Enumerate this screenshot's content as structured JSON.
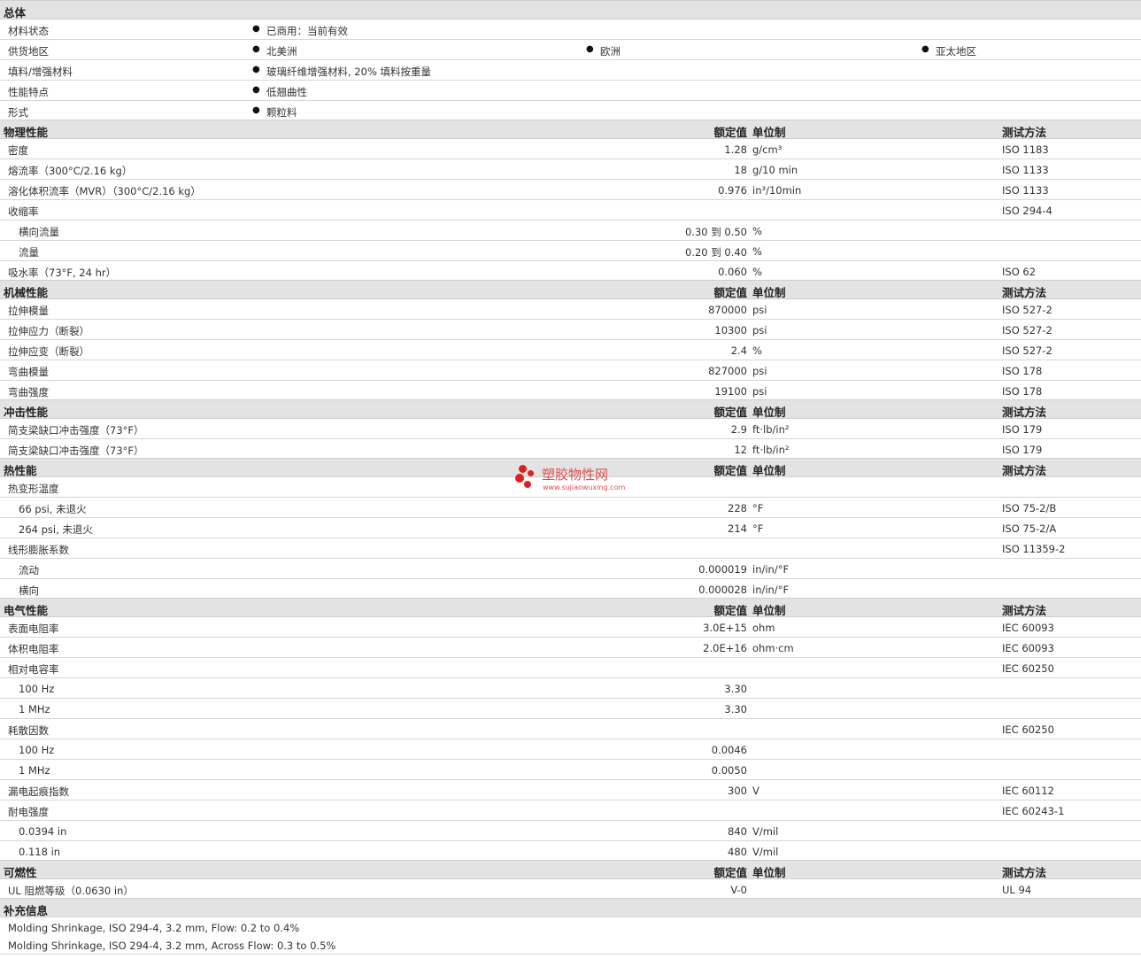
{
  "headers": {
    "nominal": "额定值",
    "unit": "单位制",
    "method": "测试方法"
  },
  "general": {
    "title": "总体",
    "rows": [
      {
        "label": "材料状态",
        "items": [
          "已商用：当前有效"
        ]
      },
      {
        "label": "供货地区",
        "items": [
          "北美洲",
          "欧洲",
          "亚太地区"
        ]
      },
      {
        "label": "填料/增强材料",
        "items": [
          "玻璃纤维增强材料, 20% 填料按重量"
        ]
      },
      {
        "label": "性能特点",
        "items": [
          "低翘曲性"
        ]
      },
      {
        "label": "形式",
        "items": [
          "颗粒料"
        ]
      }
    ]
  },
  "physical": {
    "title": "物理性能",
    "rows": [
      {
        "label": "密度",
        "value": "1.28",
        "unit": "g/cm³",
        "method": "ISO 1183"
      },
      {
        "label": "熔流率（300°C/2.16 kg）",
        "value": "18",
        "unit": "g/10 min",
        "method": "ISO 1133"
      },
      {
        "label": "溶化体积流率（MVR）（300°C/2.16 kg）",
        "value": "0.976",
        "unit": "in³/10min",
        "method": "ISO 1133"
      },
      {
        "label": "收缩率",
        "value": "",
        "unit": "",
        "method": "ISO 294-4"
      },
      {
        "label": "横向流量",
        "value": "0.30 到 0.50",
        "unit": "%",
        "method": "",
        "sub": true
      },
      {
        "label": "流量",
        "value": "0.20 到 0.40",
        "unit": "%",
        "method": "",
        "sub": true
      },
      {
        "label": "吸水率（73°F, 24 hr）",
        "value": "0.060",
        "unit": "%",
        "method": "ISO 62"
      }
    ]
  },
  "mechanical": {
    "title": "机械性能",
    "rows": [
      {
        "label": "拉伸模量",
        "value": "870000",
        "unit": "psi",
        "method": "ISO 527-2"
      },
      {
        "label": "拉伸应力（断裂）",
        "value": "10300",
        "unit": "psi",
        "method": "ISO 527-2"
      },
      {
        "label": "拉伸应变（断裂）",
        "value": "2.4",
        "unit": "%",
        "method": "ISO 527-2"
      },
      {
        "label": "弯曲模量",
        "value": "827000",
        "unit": "psi",
        "method": "ISO 178"
      },
      {
        "label": "弯曲强度",
        "value": "19100",
        "unit": "psi",
        "method": "ISO 178"
      }
    ]
  },
  "impact": {
    "title": "冲击性能",
    "rows": [
      {
        "label": "简支梁缺口冲击强度（73°F）",
        "value": "2.9",
        "unit": "ft·lb/in²",
        "method": "ISO 179"
      },
      {
        "label": "简支梁缺口冲击强度（73°F）",
        "value": "12",
        "unit": "ft·lb/in²",
        "method": "ISO 179"
      }
    ]
  },
  "thermal": {
    "title": "热性能",
    "rows": [
      {
        "label": "热变形温度",
        "value": "",
        "unit": "",
        "method": ""
      },
      {
        "label": "66 psi, 未退火",
        "value": "228",
        "unit": "°F",
        "method": "ISO 75-2/B",
        "sub": true
      },
      {
        "label": "264 psi, 未退火",
        "value": "214",
        "unit": "°F",
        "method": "ISO 75-2/A",
        "sub": true
      },
      {
        "label": "线形膨胀系数",
        "value": "",
        "unit": "",
        "method": "ISO 11359-2"
      },
      {
        "label": "流动",
        "value": "0.000019",
        "unit": "in/in/°F",
        "method": "",
        "sub": true
      },
      {
        "label": "横向",
        "value": "0.000028",
        "unit": "in/in/°F",
        "method": "",
        "sub": true
      }
    ]
  },
  "electrical": {
    "title": "电气性能",
    "rows": [
      {
        "label": "表面电阻率",
        "value": "3.0E+15",
        "unit": "ohm",
        "method": "IEC 60093"
      },
      {
        "label": "体积电阻率",
        "value": "2.0E+16",
        "unit": "ohm·cm",
        "method": "IEC 60093"
      },
      {
        "label": "相对电容率",
        "value": "",
        "unit": "",
        "method": "IEC 60250"
      },
      {
        "label": "100 Hz",
        "value": "3.30",
        "unit": "",
        "method": "",
        "sub": true
      },
      {
        "label": "1 MHz",
        "value": "3.30",
        "unit": "",
        "method": "",
        "sub": true
      },
      {
        "label": "耗散因数",
        "value": "",
        "unit": "",
        "method": "IEC 60250"
      },
      {
        "label": "100 Hz",
        "value": "0.0046",
        "unit": "",
        "method": "",
        "sub": true
      },
      {
        "label": "1 MHz",
        "value": "0.0050",
        "unit": "",
        "method": "",
        "sub": true
      },
      {
        "label": "漏电起痕指数",
        "value": "300",
        "unit": "V",
        "method": "IEC 60112"
      },
      {
        "label": "耐电强度",
        "value": "",
        "unit": "",
        "method": "IEC 60243-1"
      },
      {
        "label": "0.0394 in",
        "value": "840",
        "unit": "V/mil",
        "method": "",
        "sub": true
      },
      {
        "label": "0.118 in",
        "value": "480",
        "unit": "V/mil",
        "method": "",
        "sub": true
      }
    ]
  },
  "flammability": {
    "title": "可燃性",
    "rows": [
      {
        "label": "UL 阻燃等级（0.0630 in）",
        "value": "V-0",
        "unit": "",
        "method": "UL 94"
      }
    ]
  },
  "supplement": {
    "title": "补充信息",
    "notes": [
      "Molding Shrinkage, ISO 294-4, 3.2 mm, Flow: 0.2 to 0.4%",
      "Molding Shrinkage, ISO 294-4, 3.2 mm, Across Flow: 0.3 to 0.5%"
    ]
  },
  "watermark": {
    "name": "塑胶物性网",
    "url": "www.sujiaowuxing.com",
    "color": "#e02020"
  }
}
